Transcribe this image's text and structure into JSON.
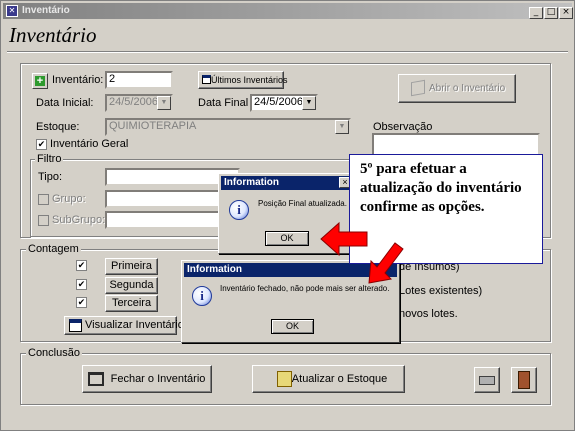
{
  "window": {
    "title": "Inventário",
    "min": "_",
    "max": "□",
    "close": "×"
  },
  "page_title": "Inventário",
  "form": {
    "inventario_label": "Inventário:",
    "inventario_value": "2",
    "ultimos_button": "Últimos Inventários",
    "abrir_button": "Abrir o Inventário",
    "data_inicial_label": "Data Inicial:",
    "data_inicial_value": "24/5/2006",
    "data_final_label": "Data Final",
    "data_final_value": "24/5/2006",
    "estoque_label": "Estoque:",
    "estoque_value": "QUIMIOTERAPIA",
    "inventario_geral_label": "Inventário Geral",
    "observacao_label": "Observação"
  },
  "filtro": {
    "label": "Filtro",
    "tipo_label": "Tipo:",
    "grupo_label": "Grupo:",
    "subgrupo_label": "SubGrupo:"
  },
  "contagem": {
    "label": "Contagem",
    "primeira": "Primeira",
    "segunda": "Segunda",
    "terceira": "Terceira",
    "visualizar": "Visualizar Inventário",
    "options": [
      "de Insumos)",
      "Lotes existentes)",
      "novos lotes."
    ]
  },
  "conclusao": {
    "label": "Conclusão",
    "fechar": "Fechar o Inventário",
    "atualizar": "Atualizar o Estoque"
  },
  "dialog1": {
    "title": "Information",
    "message": "Posição Final atualizada.",
    "ok": "OK",
    "close": "×"
  },
  "dialog2": {
    "title": "Information",
    "message": "Inventário fechado, não pode mais ser alterado.",
    "ok": "OK"
  },
  "callout": {
    "text": "5º para efetuar a atualização do inventário confirme as opções."
  },
  "colors": {
    "arrow": "#ff0000",
    "dialog_title": "#0a246a"
  }
}
